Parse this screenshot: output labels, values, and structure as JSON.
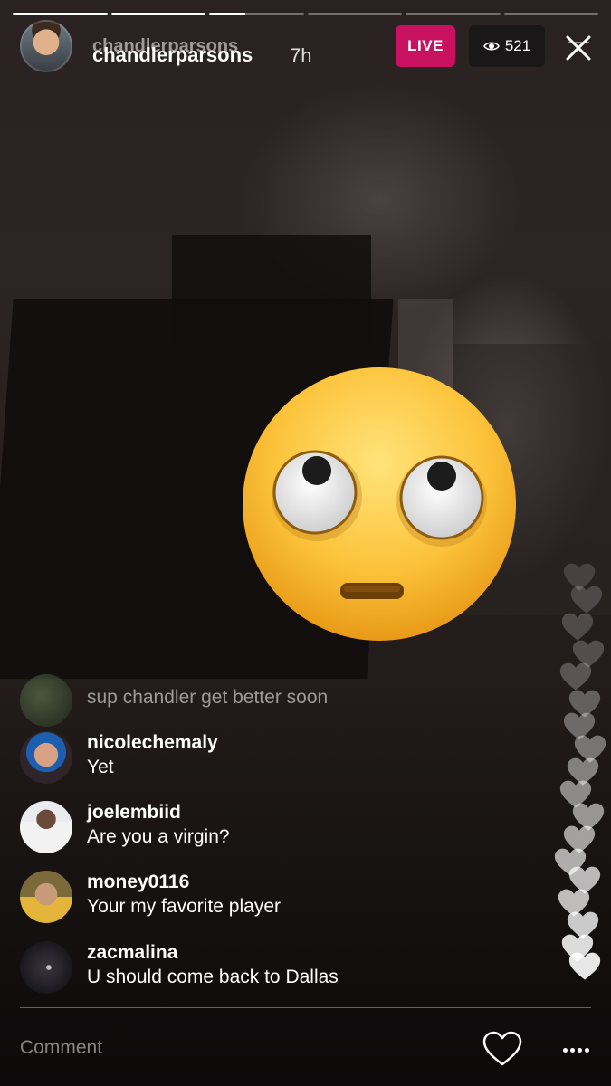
{
  "story": {
    "segments": [
      1,
      1,
      0.38,
      0,
      0,
      0
    ]
  },
  "header": {
    "username": "chandlerparsons",
    "username_ghost": "chandlerparsons",
    "elapsed": "7h",
    "live_label": "LIVE",
    "viewer_count": "521",
    "viewer_icon": "eye-icon",
    "close_icon": "close-icon"
  },
  "overlay": {
    "emoji": "face-with-rolling-eyes"
  },
  "comments": [
    {
      "user": "",
      "message": "sup chandler get better soon",
      "faded": true
    },
    {
      "user": "nicolechemaly",
      "message": "Yet"
    },
    {
      "user": "joelembiid",
      "message": "Are you a virgin?"
    },
    {
      "user": "money0116",
      "message": "Your my favorite player"
    },
    {
      "user": "zacmalina",
      "message": "U should come back to Dallas"
    }
  ],
  "footer": {
    "comment_placeholder": "Comment",
    "like_icon": "heart-outline-icon",
    "more_icon": "more-options-icon"
  },
  "colors": {
    "live_badge": "#c8125f",
    "viewer_badge_bg": "#141414",
    "text": "#ffffff"
  }
}
